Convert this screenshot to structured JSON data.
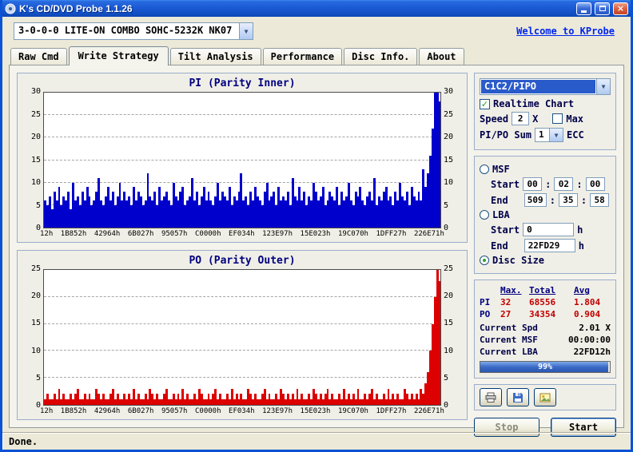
{
  "window": {
    "title": "K's CD/DVD Probe 1.1.26",
    "status": "Done."
  },
  "toolbar": {
    "drive": "3-0-0-0 LITE-ON COMBO SOHC-5232K NK07",
    "link": "Welcome to KProbe"
  },
  "tabs": [
    {
      "label": "Raw Cmd",
      "active": false
    },
    {
      "label": "Write Strategy",
      "active": true
    },
    {
      "label": "Tilt Analysis",
      "active": false
    },
    {
      "label": "Performance",
      "active": false
    },
    {
      "label": "Disc Info.",
      "active": false
    },
    {
      "label": "About",
      "active": false
    }
  ],
  "controls": {
    "mode_select": "C1C2/PIPO",
    "realtime_chart": "Realtime Chart",
    "speed_label": "Speed",
    "speed_value": "2",
    "speed_x": "X",
    "max_label": "Max",
    "pipo_sum_label": "PI/PO Sum",
    "pipo_sum_value": "1",
    "ecc_label": "ECC",
    "msf": {
      "label": "MSF",
      "start_label": "Start",
      "start": [
        "00",
        "02",
        "00"
      ],
      "end_label": "End",
      "end": [
        "509",
        "35",
        "58"
      ],
      "sep": ":"
    },
    "lba": {
      "label": "LBA",
      "start_label": "Start",
      "start": "0",
      "end_label": "End",
      "end": "22FD29",
      "unit": "h"
    },
    "disc_size_label": "Disc Size"
  },
  "stats": {
    "headers": [
      "Max.",
      "Total",
      "Avg"
    ],
    "rows": [
      {
        "label": "PI",
        "max": "32",
        "total": "68556",
        "avg": "1.804"
      },
      {
        "label": "PO",
        "max": "27",
        "total": "34354",
        "avg": "0.904"
      }
    ],
    "current": [
      {
        "label": "Current Spd",
        "value": "2.01 X"
      },
      {
        "label": "Current MSF",
        "value": "00:00:00"
      },
      {
        "label": "Current LBA",
        "value": "22FD12h"
      }
    ],
    "progress": "99%"
  },
  "actions": {
    "stop": "Stop",
    "start": "Start"
  },
  "icons": {
    "dropdown": "▼",
    "check": "✓",
    "close": "×",
    "buttons": [
      "printer-icon",
      "save-icon",
      "snapshot-icon"
    ]
  },
  "colors": {
    "pi_bar": "#0000CC",
    "po_bar": "#DD0000",
    "stat_value_red": "#C00000",
    "title_navy": "#000080",
    "link_blue": "#0026EE",
    "titlebar_blue": "#1C5CD6"
  },
  "chart_data": [
    {
      "type": "bar",
      "title": "PI (Parity Inner)",
      "color": "#0000CC",
      "ylim": [
        0,
        30
      ],
      "yticks": [
        0,
        5,
        10,
        15,
        20,
        25,
        30
      ],
      "grid": true,
      "x_labels": [
        "12h",
        "1B852h",
        "42964h",
        "6B027h",
        "95057h",
        "C0000h",
        "EF034h",
        "123E97h",
        "15E023h",
        "19C070h",
        "1DFF27h",
        "226E71h"
      ],
      "values": [
        6,
        5,
        7,
        4,
        8,
        6,
        9,
        5,
        7,
        6,
        8,
        4,
        10,
        6,
        7,
        5,
        8,
        6,
        9,
        7,
        5,
        6,
        8,
        11,
        6,
        5,
        7,
        9,
        6,
        8,
        5,
        7,
        10,
        6,
        8,
        6,
        7,
        5,
        9,
        6,
        8,
        7,
        5,
        6,
        12,
        7,
        6,
        8,
        5,
        9,
        6,
        7,
        8,
        6,
        5,
        10,
        7,
        6,
        8,
        9,
        5,
        6,
        7,
        11,
        6,
        8,
        5,
        7,
        9,
        6,
        8,
        6,
        5,
        7,
        10,
        6,
        8,
        7,
        6,
        9,
        5,
        7,
        6,
        8,
        12,
        6,
        7,
        5,
        8,
        6,
        9,
        7,
        6,
        5,
        8,
        10,
        6,
        7,
        8,
        5,
        9,
        6,
        7,
        6,
        8,
        5,
        11,
        7,
        6,
        9,
        6,
        8,
        5,
        7,
        6,
        10,
        8,
        6,
        7,
        9,
        5,
        6,
        8,
        7,
        6,
        9,
        5,
        8,
        6,
        7,
        10,
        6,
        5,
        8,
        7,
        9,
        6,
        5,
        7,
        8,
        6,
        11,
        5,
        7,
        6,
        8,
        9,
        6,
        7,
        5,
        8,
        6,
        10,
        7,
        6,
        8,
        5,
        9,
        7,
        6,
        8,
        6,
        13,
        9,
        12,
        16,
        22,
        30,
        30,
        28
      ]
    },
    {
      "type": "bar",
      "title": "PO (Parity Outer)",
      "color": "#DD0000",
      "ylim": [
        0,
        25
      ],
      "yticks": [
        0,
        5,
        10,
        15,
        20,
        25
      ],
      "grid": true,
      "x_labels": [
        "12h",
        "1B852h",
        "42964h",
        "6B027h",
        "95057h",
        "C0000h",
        "EF034h",
        "123E97h",
        "15E023h",
        "19C070h",
        "1DFF27h",
        "226E71h"
      ],
      "values": [
        1,
        2,
        1,
        1,
        2,
        1,
        3,
        1,
        2,
        1,
        1,
        2,
        1,
        2,
        3,
        1,
        1,
        2,
        1,
        2,
        1,
        1,
        3,
        2,
        1,
        2,
        1,
        1,
        2,
        3,
        1,
        2,
        1,
        1,
        2,
        1,
        2,
        1,
        3,
        1,
        2,
        1,
        1,
        2,
        1,
        3,
        2,
        1,
        2,
        1,
        1,
        2,
        3,
        1,
        1,
        2,
        1,
        2,
        1,
        3,
        1,
        2,
        1,
        1,
        2,
        1,
        3,
        2,
        1,
        1,
        2,
        1,
        2,
        3,
        1,
        2,
        1,
        1,
        2,
        1,
        3,
        1,
        2,
        1,
        2,
        1,
        1,
        3,
        2,
        1,
        2,
        1,
        1,
        2,
        3,
        1,
        2,
        1,
        1,
        2,
        1,
        3,
        2,
        1,
        2,
        1,
        2,
        1,
        3,
        1,
        2,
        1,
        1,
        2,
        1,
        3,
        2,
        1,
        2,
        1,
        2,
        3,
        1,
        2,
        1,
        1,
        2,
        1,
        3,
        1,
        2,
        1,
        2,
        1,
        3,
        1,
        1,
        2,
        1,
        2,
        3,
        1,
        2,
        1,
        1,
        2,
        1,
        3,
        1,
        2,
        1,
        2,
        1,
        1,
        3,
        2,
        1,
        2,
        1,
        2,
        1,
        3,
        2,
        4,
        6,
        10,
        15,
        20,
        25,
        23
      ]
    }
  ]
}
